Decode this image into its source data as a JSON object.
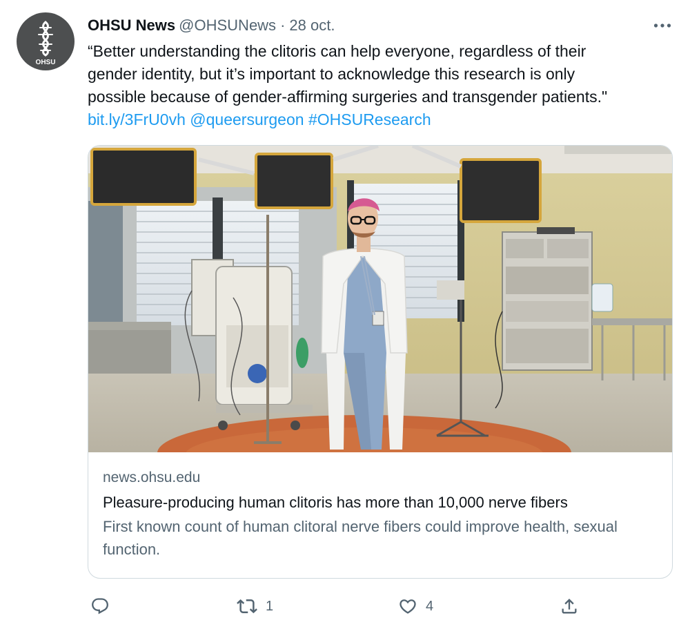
{
  "author": {
    "display_name": "OHSU News",
    "handle": "@OHSUNews",
    "separator": "·",
    "date": "28 oct.",
    "avatar_label": "OHSU"
  },
  "tweet": {
    "line1": "“Better understanding the clitoris can help everyone, regardless of their",
    "line2": "gender identity, but it’s important to acknowledge this research is only",
    "line3": "possible because of gender-affirming surgeries and transgender patients.\"",
    "link": "bit.ly/3FrU0vh",
    "mention": "@queersurgeon",
    "hashtag": "#OHSUResearch"
  },
  "card": {
    "domain": "news.ohsu.edu",
    "title": "Pleasure-producing human clitoris has more than 10,000 nerve fibers",
    "description": "First known count of human clitoral nerve fibers could improve health, sexual function."
  },
  "actions": {
    "reply_count": "",
    "retweet_count": "1",
    "like_count": "4"
  },
  "icons": [
    "ohsu-logo-icon",
    "more-icon",
    "reply-icon",
    "retweet-icon",
    "like-icon",
    "share-icon"
  ],
  "colors": {
    "link": "#1d9bf0",
    "secondary_text": "#536471",
    "border": "#cfd9de",
    "avatar_bg": "#4d4f50"
  }
}
